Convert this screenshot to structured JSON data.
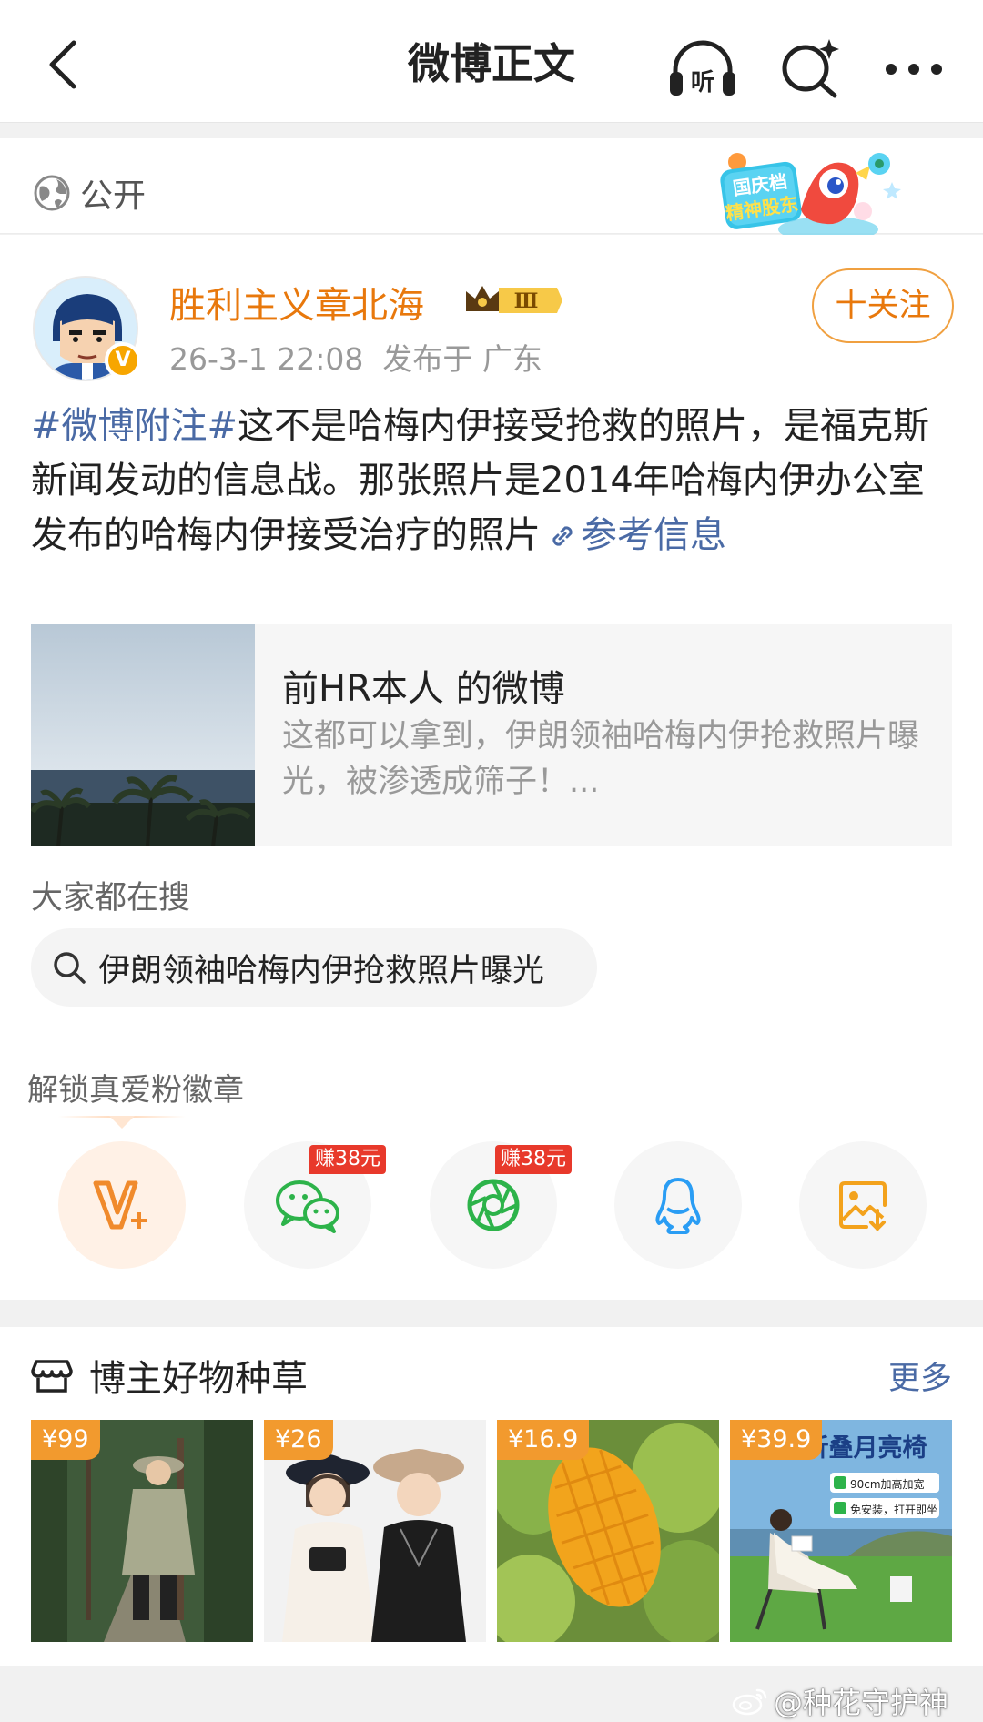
{
  "header": {
    "title": "微博正文"
  },
  "visibility": {
    "label": "公开"
  },
  "promo": {
    "line1": "国庆档",
    "line2": "精神股东"
  },
  "post": {
    "author": "胜利主义章北海",
    "verified_badge": "V",
    "level_badge": "Ⅲ",
    "time": "26-3-1 22:08",
    "location": "发布于 广东",
    "follow_label": "十关注",
    "topic": "#微博附注#",
    "text": "这不是哈梅内伊接受抢救的照片，是福克斯新闻发动的信息战。那张照片是2014年哈梅内伊办公室发布的哈梅内伊接受治疗的照片",
    "link_label": "参考信息"
  },
  "quote": {
    "title": "前HR本人 的微博",
    "description": "这都可以拿到，伊朗领袖哈梅内伊抢救照片曝光，被渗透成筛子！..."
  },
  "search": {
    "heading": "大家都在搜",
    "query": "伊朗领袖哈梅内伊抢救照片曝光"
  },
  "fan_badge": {
    "heading": "解锁真爱粉徽章"
  },
  "share": [
    {
      "icon": "vplus-icon",
      "earn": ""
    },
    {
      "icon": "wechat-icon",
      "earn": "赚38元"
    },
    {
      "icon": "moments-icon",
      "earn": "赚38元"
    },
    {
      "icon": "qq-icon",
      "earn": ""
    },
    {
      "icon": "save-image-icon",
      "earn": ""
    }
  ],
  "goods": {
    "title": "博主好物种草",
    "more": "更多",
    "items": [
      {
        "price": "¥99"
      },
      {
        "price": "¥26"
      },
      {
        "price": "¥16.9"
      },
      {
        "price": "¥39.9",
        "banner": "超音折叠月亮椅",
        "tag1": "90cm加高加宽",
        "tag2": "免安装，打开即坐"
      }
    ]
  },
  "watermark": "@种花守护神",
  "colors": {
    "accent_orange": "#e8780c",
    "link_blue": "#4a6aa5",
    "price_orange": "#f29a2e",
    "earn_red": "#e8392b"
  }
}
